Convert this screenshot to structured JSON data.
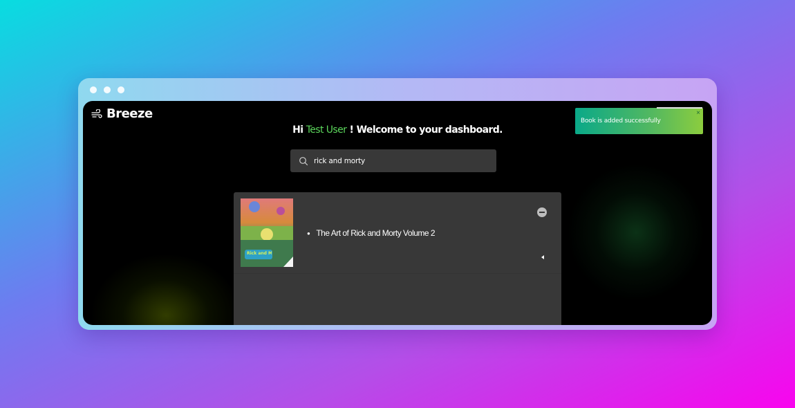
{
  "app": {
    "name": "Breeze",
    "logo_icon": "wind-icon"
  },
  "greeting": {
    "prefix": "Hi",
    "user": "Test User",
    "suffix": "! Welcome to your dashboard."
  },
  "search": {
    "value": "rick and morty",
    "icon": "search-icon"
  },
  "results": [
    {
      "title": "The Art of Rick and Morty Volume 2",
      "cover_text": "Rick and Morty"
    }
  ],
  "toast": {
    "message": "Book is added successfully",
    "close": "×"
  },
  "colors": {
    "accent_green": "#5cd65c",
    "toast_start": "#0aa989",
    "toast_end": "#8ccd3e",
    "panel": "#383838"
  }
}
